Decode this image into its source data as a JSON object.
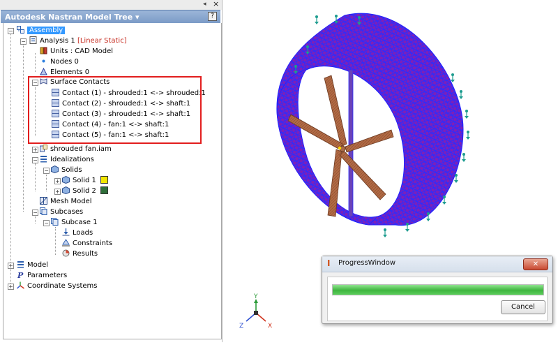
{
  "panel": {
    "title": "Autodesk Nastran Model Tree ▾",
    "pin_glyph": "◂",
    "close_glyph": "×",
    "help_glyph": "?"
  },
  "tree": {
    "assembly": "Assembly",
    "analysis": "Analysis 1",
    "analysis_type": "[Linear Static]",
    "units": "Units : CAD Model",
    "nodes": "Nodes 0",
    "elements": "Elements 0",
    "surface_contacts": "Surface Contacts",
    "contacts": [
      "Contact (1) - shrouded:1 <-> shrouded:1",
      "Contact (2) - shrouded:1 <-> shaft:1",
      "Contact (3) - shrouded:1 <-> shaft:1",
      "Contact (4) - fan:1 <-> shaft:1",
      "Contact (5) - fan:1 <-> shaft:1"
    ],
    "part": "shrouded fan.iam",
    "idealizations": "Idealizations",
    "solids": "Solids",
    "solid1": "Solid 1",
    "solid2": "Solid 2",
    "mesh_model": "Mesh Model",
    "subcases": "Subcases",
    "subcase1": "Subcase 1",
    "loads": "Loads",
    "constraints": "Constraints",
    "results": "Results",
    "model": "Model",
    "parameters": "Parameters",
    "coordinate_systems": "Coordinate Systems"
  },
  "colors": {
    "solid1": "#f2e600",
    "solid2": "#2f6f3a",
    "mesh_face": "#8a1fb4",
    "mesh_edge": "#1f22ff",
    "blade": "#b06a45",
    "constraint": "#1d9c8f"
  },
  "axes": {
    "x": "X",
    "y": "Y",
    "z": "Z"
  },
  "progress": {
    "title": "ProgressWindow",
    "icon": "I",
    "close": "✕",
    "cancel": "Cancel",
    "fraction": 1.0
  }
}
